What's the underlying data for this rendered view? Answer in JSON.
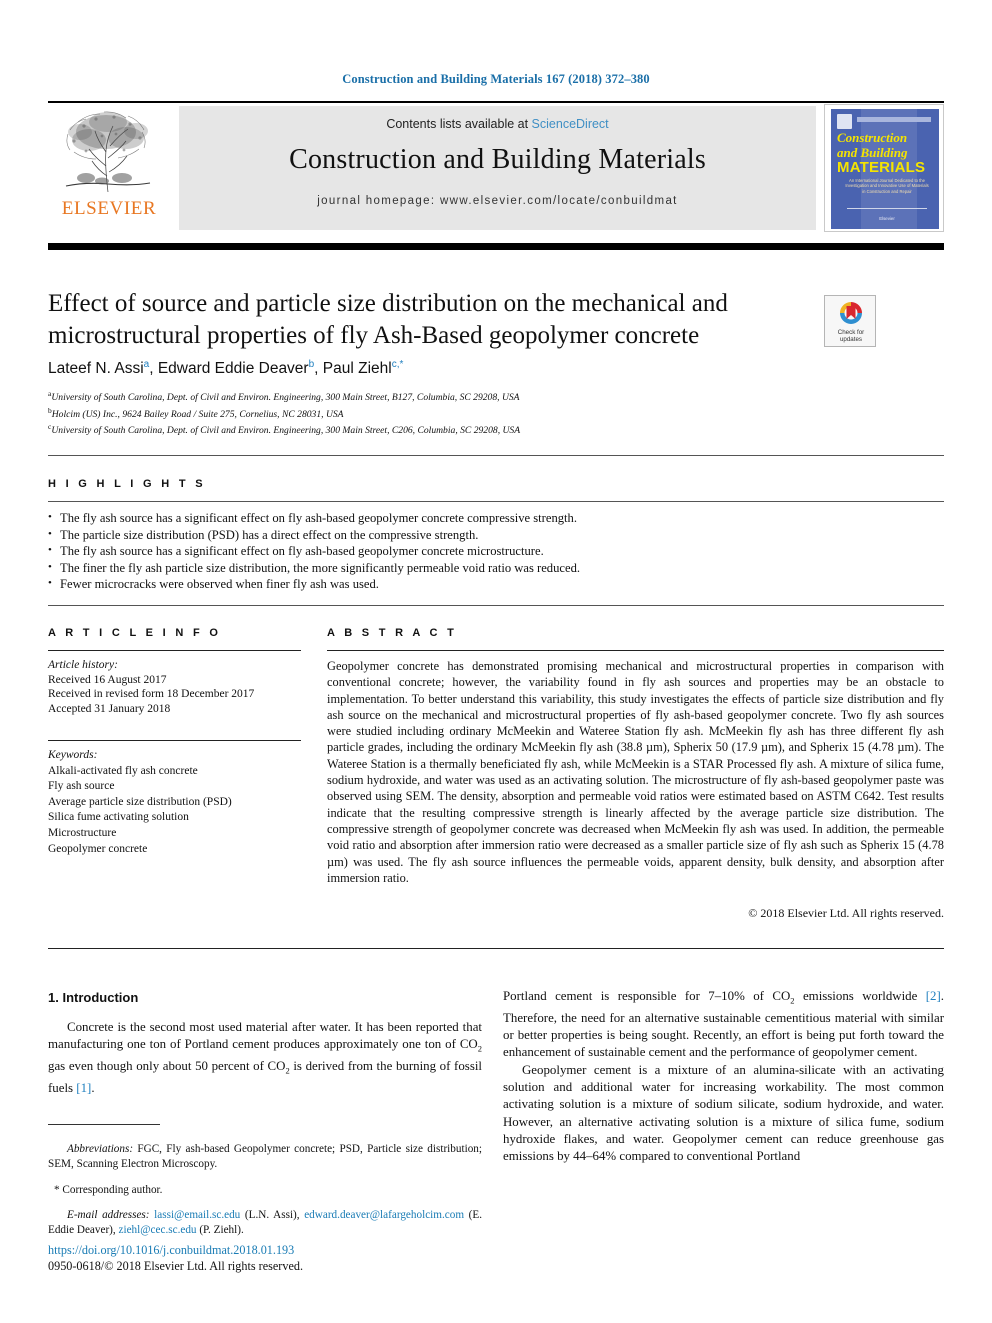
{
  "running_head": "Construction and Building Materials 167 (2018) 372–380",
  "masthead": {
    "contents_prefix": "Contents lists available at ",
    "sciencedirect": "ScienceDirect",
    "journal_name": "Construction and Building Materials",
    "homepage": "journal homepage: www.elsevier.com/locate/conbuildmat",
    "publisher": "ELSEVIER",
    "cover": {
      "line1": "Construction",
      "line2": "and Building",
      "line3": "MATERIALS",
      "subtitle": "An International Journal Dedicated to the Investigation and Innovative Use of Materials in Construction and Repair",
      "bottom": "Elsevier"
    }
  },
  "article": {
    "title": "Effect of source and particle size distribution on the mechanical and microstructural properties of fly Ash-Based geopolymer concrete",
    "crossmark_line1": "Check for",
    "crossmark_line2": "updates",
    "authors_html": "Lateef N. Assi<sup>a</sup>, Edward Eddie Deaver<sup>b</sup>, Paul Ziehl<sup>c,*</sup>",
    "affiliations": [
      {
        "marker": "a",
        "text": "University of South Carolina, Dept. of Civil and Environ. Engineering, 300 Main Street, B127, Columbia, SC 29208, USA"
      },
      {
        "marker": "b",
        "text": "Holcim (US) Inc., 9624 Bailey Road / Suite 275, Cornelius, NC 28031, USA"
      },
      {
        "marker": "c",
        "text": "University of South Carolina, Dept. of Civil and Environ. Engineering, 300 Main Street, C206, Columbia, SC 29208, USA"
      }
    ]
  },
  "highlights": {
    "heading": "H I G H L I G H T S",
    "items": [
      "The fly ash source has a significant effect on fly ash-based geopolymer concrete compressive strength.",
      "The particle size distribution (PSD) has a direct effect on the compressive strength.",
      "The fly ash source has a significant effect on fly ash-based geopolymer concrete microstructure.",
      "The finer the fly ash particle size distribution, the more significantly permeable void ratio was reduced.",
      "Fewer microcracks were observed when finer fly ash was used."
    ]
  },
  "article_info": {
    "heading": "A R T I C L E  I N F O",
    "history_label": "Article history:",
    "history": [
      "Received 16 August 2017",
      "Received in revised form 18 December 2017",
      "Accepted 31 January 2018"
    ],
    "keywords_label": "Keywords:",
    "keywords": [
      "Alkali-activated fly ash concrete",
      "Fly ash source",
      "Average particle size distribution (PSD)",
      "Silica fume activating solution",
      "Microstructure",
      "Geopolymer concrete"
    ]
  },
  "abstract": {
    "heading": "A B S T R A C T",
    "text": "Geopolymer concrete has demonstrated promising mechanical and microstructural properties in comparison with conventional concrete; however, the variability found in fly ash sources and properties may be an obstacle to implementation. To better understand this variability, this study investigates the effects of particle size distribution and fly ash source on the mechanical and microstructural properties of fly ash-based geopolymer concrete. Two fly ash sources were studied including ordinary McMeekin and Wateree Station fly ash. McMeekin fly ash has three different fly ash particle grades, including the ordinary McMeekin fly ash (38.8 µm), Spherix 50 (17.9 µm), and Spherix 15 (4.78 µm). The Wateree Station is a thermally beneficiated fly ash, while McMeekin is a STAR Processed fly ash. A mixture of silica fume, sodium hydroxide, and water was used as an activating solution. The microstructure of fly ash-based geopolymer paste was observed using SEM. The density, absorption and permeable void ratios were estimated based on ASTM C642. Test results indicate that the resulting compressive strength is linearly affected by the average particle size distribution. The compressive strength of geopolymer concrete was decreased when McMeekin fly ash was used. In addition, the permeable void ratio and absorption after immersion ratio were decreased as a smaller particle size of fly ash such as Spherix 15 (4.78 µm) was used. The fly ash source influences the permeable voids, apparent density, bulk density, and absorption after immersion ratio.",
    "copyright": "© 2018 Elsevier Ltd. All rights reserved."
  },
  "body": {
    "section_heading": "1. Introduction",
    "left_paragraph": "Concrete is the second most used material after water. It has been reported that manufacturing one ton of Portland cement produces approximately one ton of CO2 gas even though only about 50 percent of CO2 is derived from the burning of fossil fuels [1].",
    "right_paragraph_1": "Portland cement is responsible for 7–10% of CO2 emissions worldwide [2]. Therefore, the need for an alternative sustainable cementitious material with similar or better properties is being sought. Recently, an effort is being put forth toward the enhancement of sustainable cement and the performance of geopolymer cement.",
    "right_paragraph_2": "Geopolymer cement is a mixture of an alumina-silicate with an activating solution and additional water for increasing workability. The most common activating solution is a mixture of sodium silicate, sodium hydroxide, and water. However, an alternative activating solution is a mixture of silica fume, sodium hydroxide flakes, and water. Geopolymer cement can reduce greenhouse gas emissions by 44–64% compared to conventional Portland"
  },
  "footnotes": {
    "abbrev_label": "Abbreviations:",
    "abbrev_text": " FGC, Fly ash-based Geopolymer concrete; PSD, Particle size distribution; SEM, Scanning Electron Microscopy.",
    "corresponding": "* Corresponding author.",
    "email_label": "E-mail addresses:",
    "email_1": "lassi@email.sc.edu",
    "email_1_name": " (L.N. Assi), ",
    "email_2": "edward.deaver@lafargeholcim.com",
    "email_2_name": " (E. Eddie Deaver), ",
    "email_3": "ziehl@cec.sc.edu",
    "email_3_name": " (P. Ziehl).",
    "doi": "https://doi.org/10.1016/j.conbuildmat.2018.01.193",
    "issn_line": "0950-0618/© 2018 Elsevier Ltd. All rights reserved."
  },
  "colors": {
    "link_blue": "#1a7cb5",
    "elsevier_orange": "#E87722",
    "cover_blue": "#4a63b0",
    "cover_yellow": "#f5e400"
  }
}
